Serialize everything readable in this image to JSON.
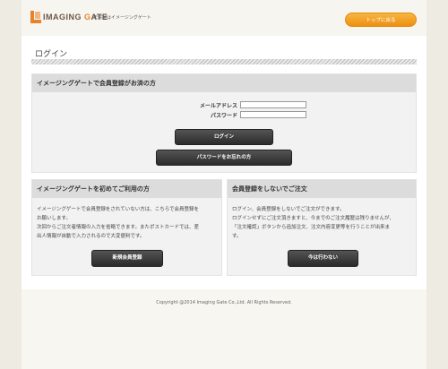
{
  "header": {
    "logo_prefix": "I",
    "logo_main": "MAGING ",
    "logo_accent": "G",
    "logo_suffix": "ATE",
    "tagline": "年賀状はイメージングゲート",
    "top_button": "トップに戻る"
  },
  "page": {
    "title": "ログイン"
  },
  "login_panel": {
    "heading": "イメージングゲートで会員登録がお済の方",
    "email_label": "メールアドレス",
    "email_value": "",
    "password_label": "パスワード",
    "password_value": "",
    "login_button": "ログイン",
    "forgot_button": "パスワードをお忘れの方"
  },
  "first_panel": {
    "heading": "イメージングゲートを初めてご利用の方",
    "lines": [
      "イメージングゲートで会員登録をされていない方は、こちらで会員登録を",
      "お願いします。",
      "次回からご注文者情報の入力を省略できます。またポストカードでは、差",
      "出人情報が自動で入力されるので大変便利です。"
    ],
    "button": "新規会員登録"
  },
  "guest_panel": {
    "heading": "会員登録をしないでご注文",
    "lines": [
      "ログイン、会員登録をしないでご注文ができます。",
      "ログインせずにご注文頂きますと、今までのご注文履歴は残りませんが、",
      "「注文確認」ボタンから追加注文、注文内容変更等を行うことが出来ま",
      "す。"
    ],
    "button": "今は行わない"
  },
  "footer": {
    "copyright": "Copyright @2014 Imaging Gate Co.,Ltd. All Rights Reserved."
  },
  "colors": {
    "accent": "#e8822a",
    "button_orange": "#f0a020",
    "button_dark": "#333333",
    "panel_head": "#dcdcdc",
    "panel_body": "#f2f2f2",
    "page_bg": "#eeebe3"
  }
}
